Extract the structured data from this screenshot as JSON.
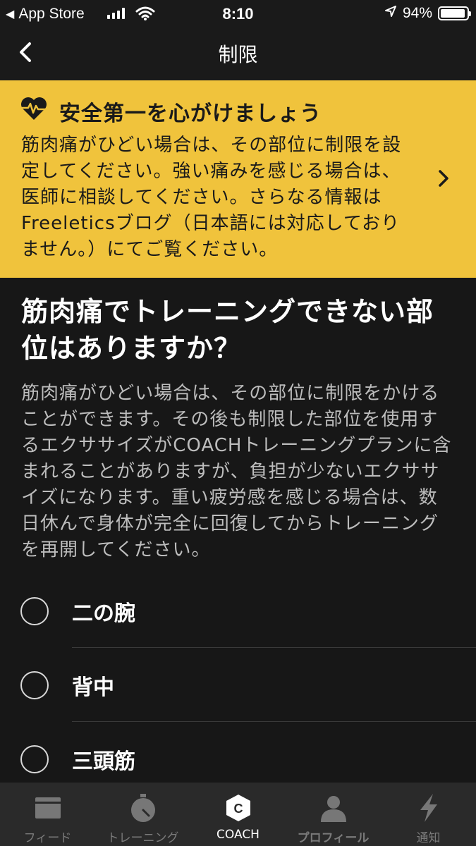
{
  "status_bar": {
    "back_app": "App Store",
    "time": "8:10",
    "battery": "94%",
    "battery_level": 0.94
  },
  "nav": {
    "title": "制限"
  },
  "banner": {
    "title": "安全第一を心がけましょう",
    "body": "筋肉痛がひどい場合は、その部位に制限を設定してください。強い痛みを感じる場合は、医師に相談してください。さらなる情報はFreeleticsブログ（日本語には対応しておりません。）にてご覧ください。"
  },
  "question": {
    "title": "筋肉痛でトレーニングできない部位はありますか？",
    "description": "筋肉痛がひどい場合は、その部位に制限をかけることができます。その後も制限した部位を使用するエクササイズがCOACHトレーニングプランに含まれることがありますが、負担が少ないエクササイズになります。重い疲労感を感じる場合は、数日休んで身体が完全に回復してからトレーニングを再開してください。"
  },
  "options": [
    {
      "label": "二の腕",
      "selected": false
    },
    {
      "label": "背中",
      "selected": false
    },
    {
      "label": "三頭筋",
      "selected": false
    }
  ],
  "tabs": [
    {
      "label": "フィード",
      "icon": "feed-icon",
      "active": false
    },
    {
      "label": "トレーニング",
      "icon": "stopwatch-icon",
      "active": false
    },
    {
      "label": "COACH",
      "icon": "coach-icon",
      "active": true
    },
    {
      "label": "プロフィール",
      "icon": "profile-icon",
      "active": false
    },
    {
      "label": "通知",
      "icon": "lightning-icon",
      "active": false
    }
  ],
  "colors": {
    "background": "#171717",
    "banner": "#f0c33c",
    "tab_bar": "#2a2a2a"
  }
}
